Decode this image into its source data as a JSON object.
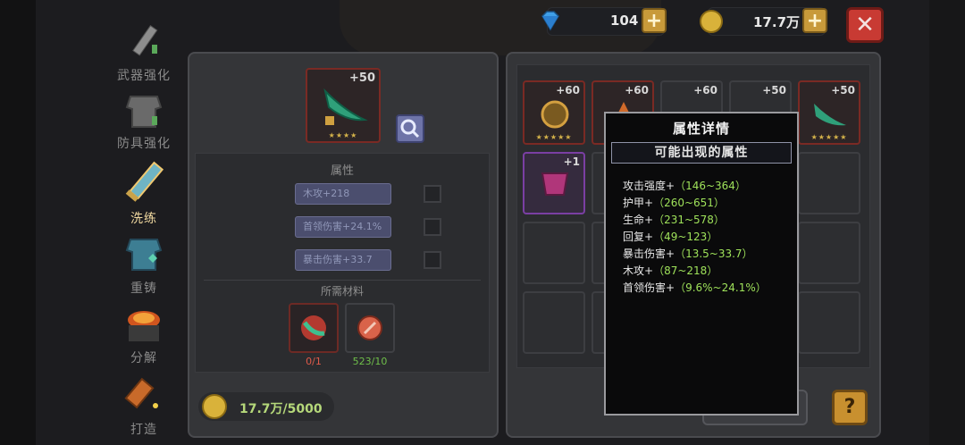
{
  "currency": {
    "gems": "104",
    "gold": "17.7万",
    "plus_label": "+",
    "close_label": "✕"
  },
  "nav": [
    {
      "label": "武器强化"
    },
    {
      "label": "防具强化"
    },
    {
      "label": "洗练"
    },
    {
      "label": "重铸"
    },
    {
      "label": "分解"
    },
    {
      "label": "打造"
    }
  ],
  "left_panel": {
    "item_level": "+50",
    "item_stars": "★★★★",
    "attributes_title": "属性",
    "attributes": [
      {
        "label": "木攻+218"
      },
      {
        "label": "首领伤害+24.1%"
      },
      {
        "label": "暴击伤害+33.7"
      }
    ],
    "materials_title": "所需材料",
    "materials": [
      {
        "count": "0/1",
        "color": "#e05a4a"
      },
      {
        "count": "523/10",
        "color": "#6fbf4a"
      }
    ],
    "gold_cost": "17.7万/5000"
  },
  "inventory": {
    "items": [
      {
        "level": "+60",
        "stars": "★★★★★"
      },
      {
        "level": "+60",
        "stars": "★★★★★"
      },
      {
        "level": "+60",
        "stars": "★★★★★"
      },
      {
        "level": "+50",
        "stars": "★★★★★"
      },
      {
        "level": "+50",
        "stars": "★★★★★"
      },
      {
        "level": "+1",
        "stars": ""
      }
    ]
  },
  "popup": {
    "title": "属性详情",
    "subtitle": "可能出现的属性",
    "props": [
      {
        "name": "攻击强度+",
        "range": "（146~364）"
      },
      {
        "name": "护甲+",
        "range": "（260~651）"
      },
      {
        "name": "生命+",
        "range": "（231~578）"
      },
      {
        "name": "回复+",
        "range": "（49~123）"
      },
      {
        "name": "暴击伤害+",
        "range": "（13.5~33.7）"
      },
      {
        "name": "木攻+",
        "range": "（87~218）"
      },
      {
        "name": "首领伤害+",
        "range": "（9.6%~24.1%）"
      }
    ]
  },
  "actions": {
    "wash_label": "洗练",
    "help_label": "?"
  },
  "colors": {
    "accent_gold": "#c8902f",
    "close_red": "#c83a33",
    "range_green": "#9fe25a"
  }
}
